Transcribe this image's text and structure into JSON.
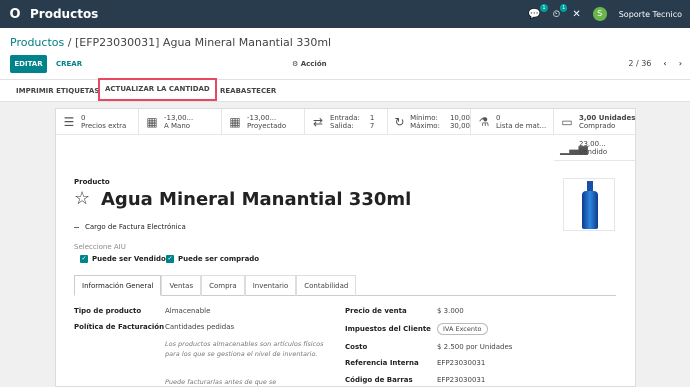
{
  "topbar": {
    "logo": "O",
    "app_name": "Productos",
    "messages_count": "1",
    "activity_count": "1",
    "user_initial": "S",
    "user_name": "Soporte Tecnico"
  },
  "breadcrumb": {
    "root": "Productos",
    "separator": "/",
    "current": "[EFP23030031] Agua Mineral Manantial 330ml"
  },
  "controls": {
    "edit": "EDITAR",
    "create": "CREAR",
    "action": "Acción",
    "pager": "2 / 36"
  },
  "header_buttons": {
    "print_labels": "IMPRIMIR ETIQUETAS",
    "update_qty": "ACTUALIZAR LA CANTIDAD",
    "replenish": "REABASTECER"
  },
  "stats": {
    "extra_prices": {
      "num": "0",
      "label": "Precios extra"
    },
    "on_hand": {
      "num": "-13,00...",
      "label": "A Mano"
    },
    "forecast": {
      "num": "-13,00...",
      "label": "Proyectado"
    },
    "moves": {
      "in_label": "Entrada:",
      "in_val": "1",
      "out_label": "Salida:",
      "out_val": "7"
    },
    "reorder": {
      "min_label": "Mínimo:",
      "min_val": "10,00",
      "max_label": "Máximo:",
      "max_val": "30,00"
    },
    "materials": {
      "num": "0",
      "label": "Lista de mat..."
    },
    "purchased": {
      "num": "3,00 Unidades",
      "label": "Comprado"
    },
    "sold": {
      "num": "23,00...",
      "label": "Vendido"
    }
  },
  "product": {
    "label": "Producto",
    "name": "Agua Mineral Manantial 330ml",
    "einvoice_charge": "Cargo de Factura Electrónica",
    "aiu_label": "Seleccione AIU",
    "can_be_sold": "Puede ser Vendido",
    "can_be_purchased": "Puede ser comprado"
  },
  "tabs": [
    "Información General",
    "Ventas",
    "Compra",
    "Inventario",
    "Contabilidad"
  ],
  "general": {
    "product_type_label": "Tipo de producto",
    "product_type_value": "Almacenable",
    "invoice_policy_label": "Política de Facturación",
    "invoice_policy_value": "Cantidades pedidas",
    "note1": "Los productos almacenables son artículos físicos para los que se gestiona el nivel de inventario.",
    "note2": "Puede facturarlas antes de que se",
    "sale_price_label": "Precio de venta",
    "sale_price_value": "$ 3.000",
    "customer_tax_label": "Impuestos del Cliente",
    "customer_tax_value": "IVA Excento",
    "cost_label": "Costo",
    "cost_value": "$ 2.500",
    "cost_unit": "por Unidades",
    "internal_ref_label": "Referencia Interna",
    "internal_ref_value": "EFP23030031",
    "barcode_label": "Código de Barras",
    "barcode_value": "EFP23030031"
  }
}
